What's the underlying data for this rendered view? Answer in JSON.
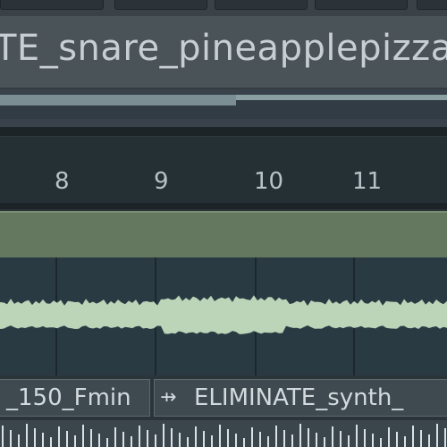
{
  "sample": {
    "title": "TE_snare_pineapplepizza"
  },
  "timeline": {
    "markers": [
      "8",
      "9",
      "10",
      "11"
    ]
  },
  "clips": {
    "left_label": "_150_Fmin",
    "right_label": "ELIMINATE_synth_",
    "right_icon": "arrow-marker-icon"
  },
  "colors": {
    "waveform": "#bcd4b8",
    "green_lane": "#64775f",
    "background": "#2b3237"
  }
}
